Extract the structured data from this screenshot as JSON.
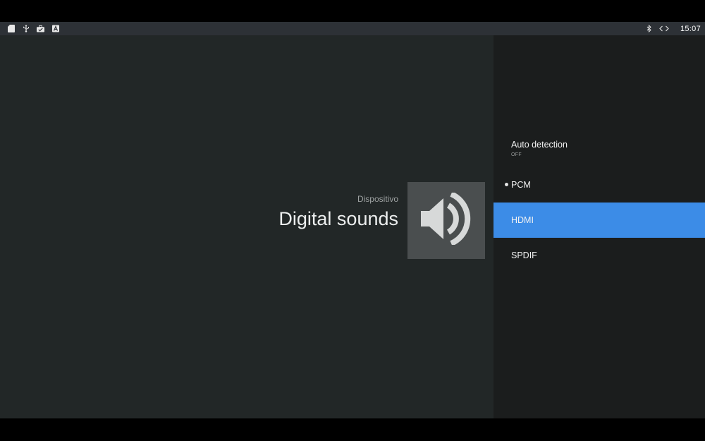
{
  "statusbar": {
    "left_icons": [
      "sd-card-icon",
      "usb-icon",
      "briefcase-icon",
      "store-icon"
    ],
    "right_icons": [
      "bluetooth-icon",
      "code-arrows-icon"
    ],
    "clock": "15:07"
  },
  "header": {
    "section": "Dispositivo",
    "title": "Digital sounds",
    "tile_icon": "speaker-icon"
  },
  "options": {
    "auto": {
      "label": "Auto detection",
      "state": "OFF"
    },
    "pcm": {
      "label": "PCM",
      "selected": true
    },
    "hdmi": {
      "label": "HDMI",
      "focused": true
    },
    "spdif": {
      "label": "SPDIF"
    }
  },
  "colors": {
    "background": "#222727",
    "panel": "#1b1d1d",
    "statusbar": "#2d3136",
    "focus": "#3c8ce7",
    "tile": "#4a4e4f"
  }
}
